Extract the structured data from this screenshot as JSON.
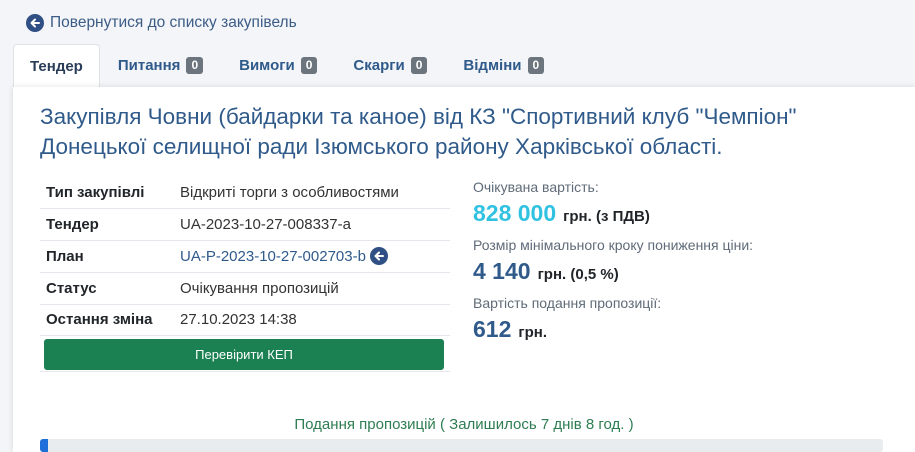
{
  "back_link": {
    "label": "Повернутися до списку закупівель",
    "icon": "arrow-left-circle-icon"
  },
  "tabs": [
    {
      "label": "Тендер",
      "active": true
    },
    {
      "label": "Питання",
      "count": "0"
    },
    {
      "label": "Вимоги",
      "count": "0"
    },
    {
      "label": "Скарги",
      "count": "0"
    },
    {
      "label": "Відміни",
      "count": "0"
    }
  ],
  "title": "Закупівля Човни (байдарки та каное) від КЗ \"Спортивний клуб \"Чемпіон\" Донецької селищної ради Ізюмського району Харківської області.",
  "info": {
    "type_key": "Тип закупівлі",
    "type_value": "Відкриті торги з особливостями",
    "tender_key": "Тендер",
    "tender_value": "UA-2023-10-27-008337-a",
    "plan_key": "План",
    "plan_value": "UA-P-2023-10-27-002703-b",
    "status_key": "Статус",
    "status_value": "Очікування пропозицій",
    "changed_key": "Остання зміна",
    "changed_value": "27.10.2023 14:38"
  },
  "kep_button": "Перевірити КЕП",
  "prices": {
    "expected_label": "Очікувана вартість:",
    "expected_amount": "828 000",
    "expected_unit": "грн. (з ПДВ)",
    "step_label": "Розмір мінімального кроку пониження ціни:",
    "step_amount": "4 140",
    "step_unit": "грн. (0,5 %)",
    "fee_label": "Вартість подання пропозиції:",
    "fee_amount": "612",
    "fee_unit": "грн."
  },
  "submission": "Подання пропозицій ( Залишилось 7 днів 8 год. )",
  "progress": {
    "fraction": 0.01
  },
  "colors": {
    "primary": "#2f5a8a",
    "accent": "#32c2e1",
    "success": "#1b8152",
    "progress": "#1e6fd9"
  }
}
